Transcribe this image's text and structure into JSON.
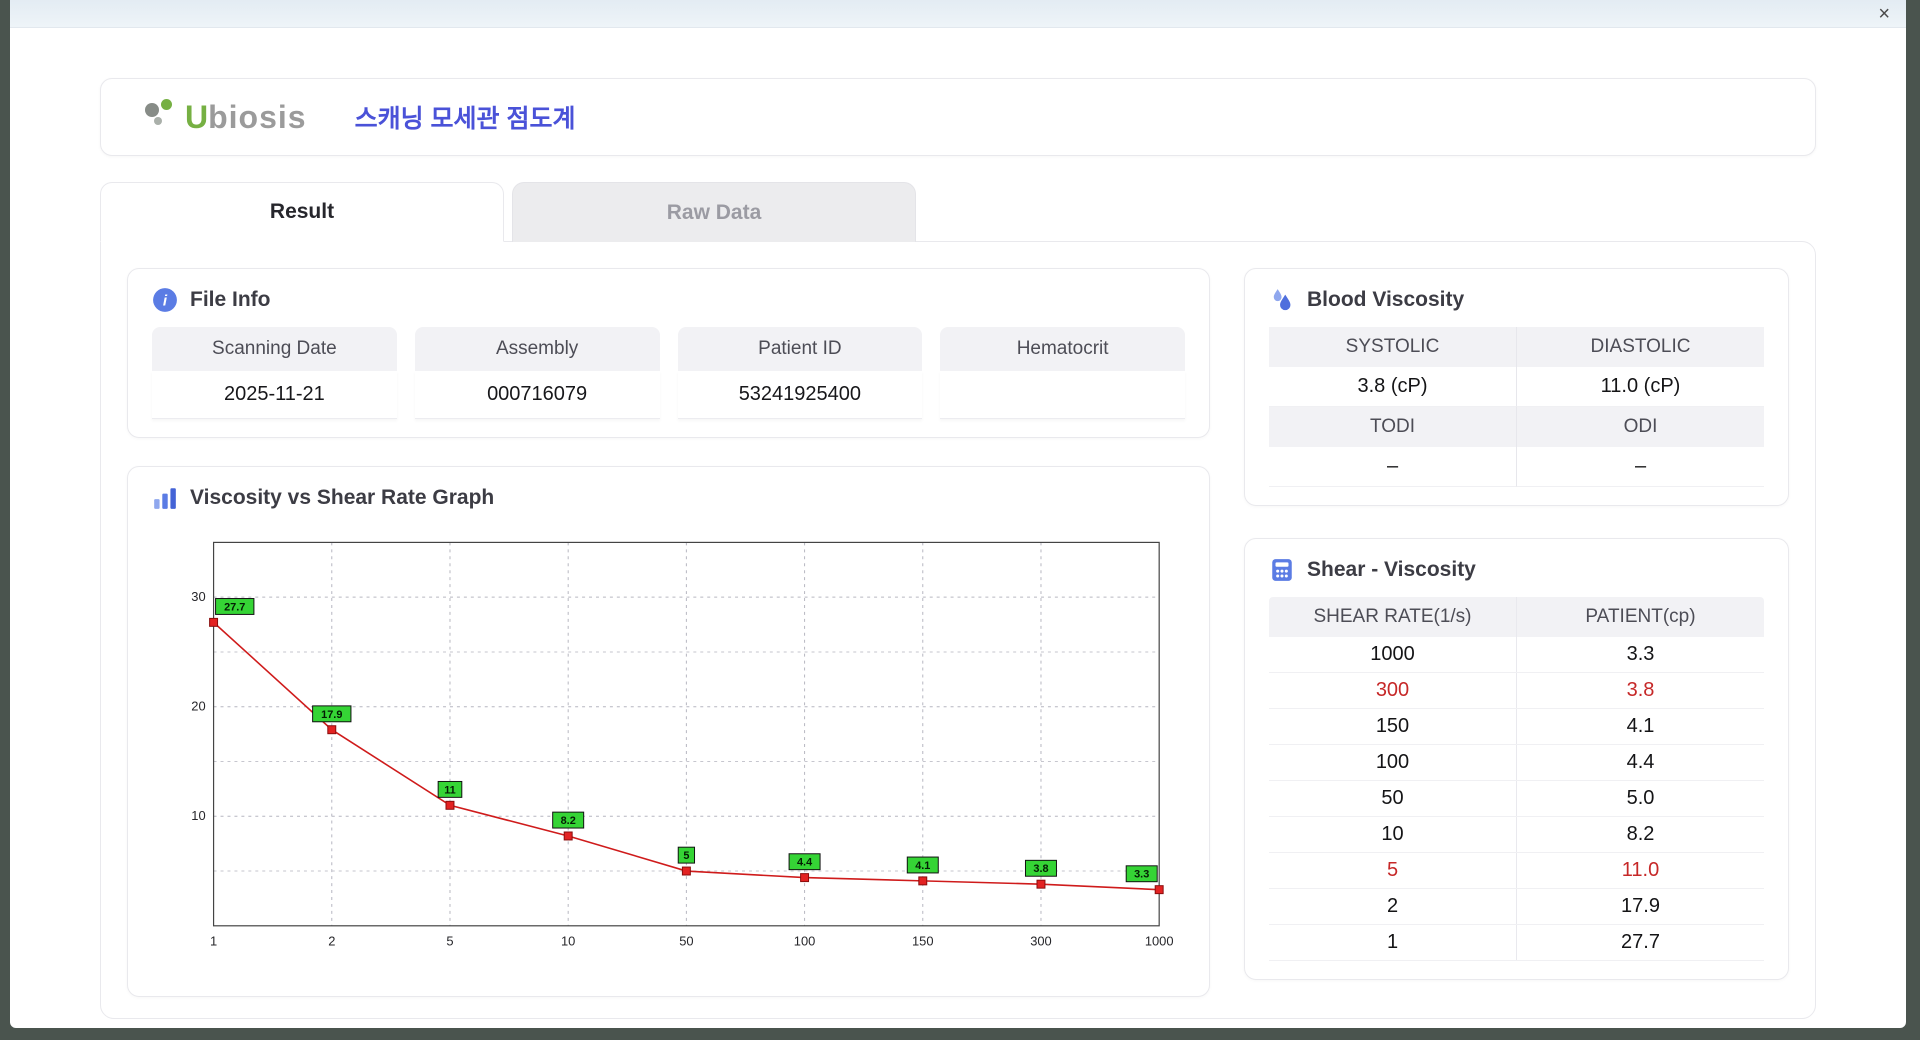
{
  "window": {
    "close_label": "×"
  },
  "header": {
    "logo_prefix": "U",
    "logo_suffix": "biosis",
    "app_title": "스캐닝 모세관 점도계"
  },
  "tabs": {
    "result": "Result",
    "raw_data": "Raw Data"
  },
  "file_info": {
    "title": "File Info",
    "fields": [
      {
        "label": "Scanning Date",
        "value": "2025-11-21"
      },
      {
        "label": "Assembly",
        "value": "000716079"
      },
      {
        "label": "Patient ID",
        "value": "53241925400"
      },
      {
        "label": "Hematocrit",
        "value": ""
      }
    ]
  },
  "blood_viscosity": {
    "title": "Blood Viscosity",
    "groups": [
      {
        "cells": [
          {
            "label": "SYSTOLIC",
            "value": "3.8 (cP)"
          },
          {
            "label": "DIASTOLIC",
            "value": "11.0 (cP)"
          }
        ]
      },
      {
        "cells": [
          {
            "label": "TODI",
            "value": "–"
          },
          {
            "label": "ODI",
            "value": "–"
          }
        ]
      }
    ]
  },
  "graph": {
    "title": "Viscosity vs Shear Rate Graph"
  },
  "chart_data": {
    "type": "line",
    "title": "Viscosity vs Shear Rate Graph",
    "x_ticks": [
      "1",
      "2",
      "5",
      "10",
      "50",
      "100",
      "150",
      "300",
      "1000"
    ],
    "x": [
      1,
      2,
      5,
      10,
      50,
      100,
      150,
      300,
      1000
    ],
    "values": [
      27.7,
      17.9,
      11,
      8.2,
      5,
      4.4,
      4.1,
      3.8,
      3.3
    ],
    "point_labels": [
      "27.7",
      "17.9",
      "11",
      "8.2",
      "5",
      "4.4",
      "4.1",
      "3.8",
      "3.3"
    ],
    "y_ticks": [
      10,
      20,
      30
    ],
    "y_grid_minor": [
      5,
      15,
      25
    ],
    "ylim": [
      0,
      35
    ],
    "x_axis_spacing": "even",
    "grid": "dashed",
    "line_color": "#cf1b1b",
    "marker_color": "#e32222",
    "marker_border": "#8a0c0c",
    "label_bg": "#35d435",
    "label_border": "#111111"
  },
  "shear_viscosity": {
    "title": "Shear - Viscosity",
    "columns": [
      "SHEAR RATE(1/s)",
      "PATIENT(cp)"
    ],
    "highlight_color": "#c62828",
    "rows": [
      {
        "shear_rate": "1000",
        "patient": "3.3",
        "highlight": false
      },
      {
        "shear_rate": "300",
        "patient": "3.8",
        "highlight": true
      },
      {
        "shear_rate": "150",
        "patient": "4.1",
        "highlight": false
      },
      {
        "shear_rate": "100",
        "patient": "4.4",
        "highlight": false
      },
      {
        "shear_rate": "50",
        "patient": "5.0",
        "highlight": false
      },
      {
        "shear_rate": "10",
        "patient": "8.2",
        "highlight": false
      },
      {
        "shear_rate": "5",
        "patient": "11.0",
        "highlight": true
      },
      {
        "shear_rate": "2",
        "patient": "17.9",
        "highlight": false
      },
      {
        "shear_rate": "1",
        "patient": "27.7",
        "highlight": false
      }
    ]
  }
}
